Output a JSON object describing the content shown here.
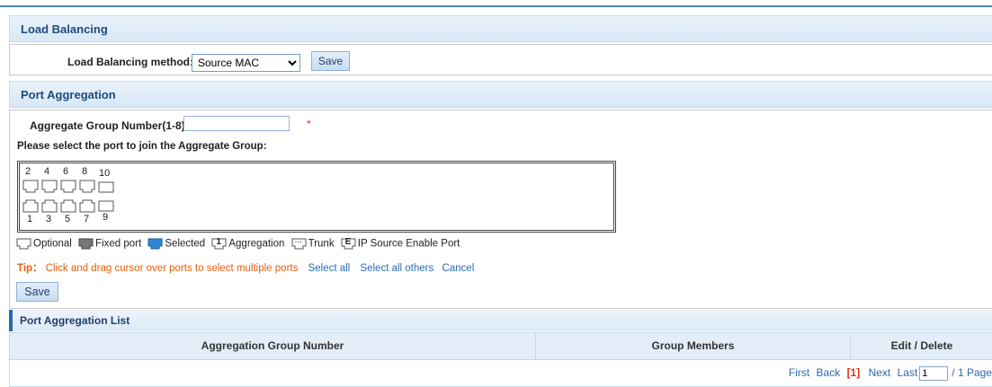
{
  "load_balancing": {
    "title": "Load Balancing",
    "method_label": "Load Balancing method:",
    "method_value": "Source MAC",
    "save_label": "Save"
  },
  "port_aggregation": {
    "title": "Port Aggregation",
    "group_number_label": "Aggregate Group Number(1-8):",
    "group_number_value": "",
    "required_mark": "*",
    "select_instruction": "Please select the port to join the Aggregate Group:",
    "top_port_numbers": [
      "2",
      "4",
      "6",
      "8",
      "10"
    ],
    "bottom_port_numbers": [
      "1",
      "3",
      "5",
      "7",
      "9"
    ],
    "legend": {
      "optional": "Optional",
      "fixed": "Fixed port",
      "selected": "Selected",
      "aggregation_icon_text": "1",
      "aggregation": "Aggregation",
      "trunk_icon_text": "...",
      "trunk": "Trunk",
      "ip_source_icon_text": "E",
      "ip_source": "IP Source Enable Port"
    },
    "tip_prefix": "Tip：",
    "tip_text": "Click and drag cursor over ports to select multiple ports",
    "select_all": "Select all",
    "select_all_others": "Select all others",
    "cancel": "Cancel",
    "save_label": "Save"
  },
  "list": {
    "title": "Port Aggregation List",
    "columns": [
      "Aggregation Group Number",
      "Group Members",
      "Edit / Delete"
    ],
    "pager": {
      "first": "First",
      "back": "Back",
      "current": "[1]",
      "next": "Next",
      "last": "Last",
      "page_input": "1",
      "total": "/ 1 Page"
    }
  },
  "colors": {
    "accent": "#2e68a8",
    "header_text": "#1f4a7a",
    "tip": "#e85d0c",
    "link": "#2a6bb4",
    "required": "#e22233"
  }
}
